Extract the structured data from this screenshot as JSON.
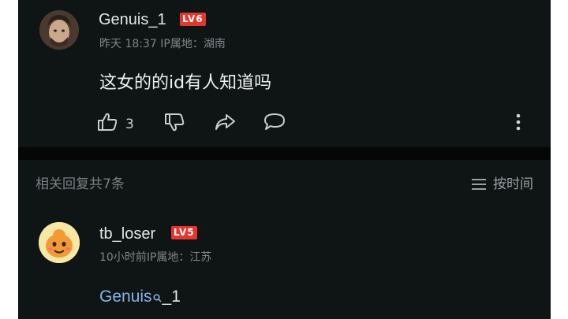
{
  "comment": {
    "username": "Genuis_1",
    "level": "LV6",
    "meta": "昨天 18:37 IP属地：湖南",
    "text": "这女的的id有人知道吗",
    "like_count": "3"
  },
  "replies_header": {
    "title": "相关回复共7条",
    "sort_label": "按时间"
  },
  "reply": {
    "username": "tb_loser",
    "level": "LV5",
    "meta": "10小时前IP属地：江苏",
    "mention": "Genuis",
    "mention_suffix": "_1"
  },
  "colors": {
    "background": "#0f1414",
    "level_badge": "#e5362d",
    "mention": "#86b4ea"
  },
  "icons": [
    "thumbs-up-icon",
    "thumbs-down-icon",
    "share-icon",
    "comment-icon",
    "more-vertical-icon",
    "sort-list-icon",
    "search-icon"
  ]
}
